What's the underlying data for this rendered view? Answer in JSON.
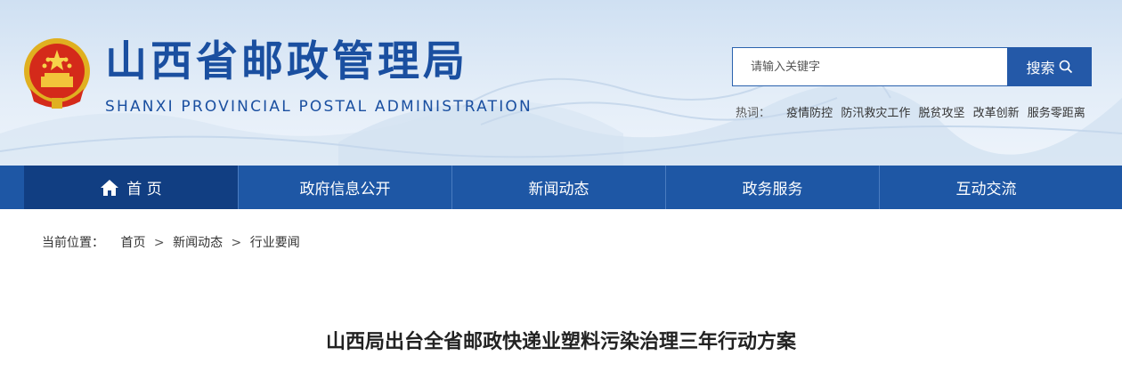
{
  "header": {
    "title": "山西省邮政管理局",
    "subtitle": "SHANXI PROVINCIAL POSTAL ADMINISTRATION",
    "emblem_icon": "national-emblem-icon"
  },
  "search": {
    "placeholder": "请输入关键字",
    "button_label": "搜索",
    "button_icon": "search-icon"
  },
  "hot_words": {
    "label": "热词：",
    "items": [
      "疫情防控",
      "防汛救灾工作",
      "脱贫攻坚",
      "改革创新",
      "服务零距离"
    ]
  },
  "nav": {
    "items": [
      {
        "label": "首 页",
        "icon": "home-icon",
        "active": true
      },
      {
        "label": "政府信息公开"
      },
      {
        "label": "新闻动态"
      },
      {
        "label": "政务服务"
      },
      {
        "label": "互动交流"
      }
    ]
  },
  "breadcrumb": {
    "label": "当前位置：",
    "items": [
      "首页",
      "新闻动态",
      "行业要闻"
    ],
    "separator": ">"
  },
  "article": {
    "title": "山西局出台全省邮政快递业塑料污染治理三年行动方案"
  },
  "colors": {
    "brand_blue": "#1e57a5",
    "nav_active": "#113e82",
    "title_blue": "#1a4fa0"
  }
}
